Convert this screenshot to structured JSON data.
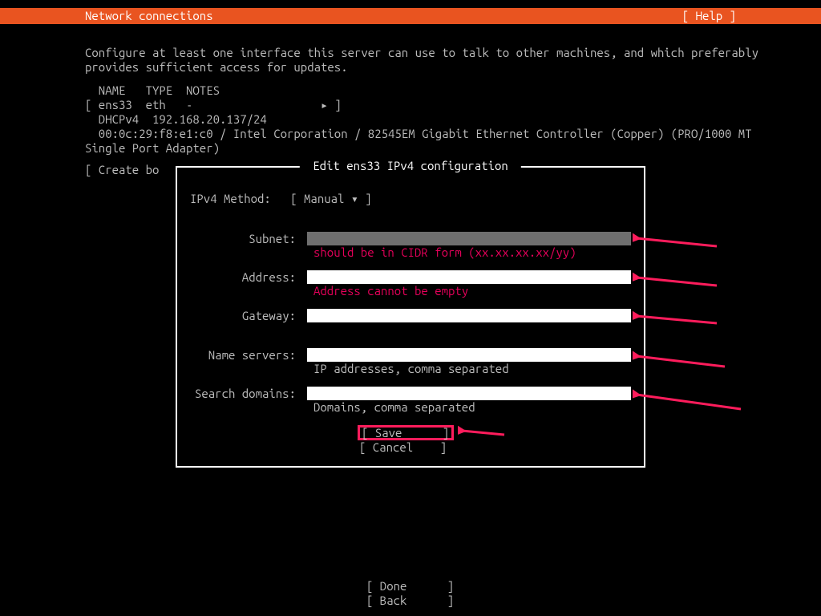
{
  "header": {
    "title": "Network connections",
    "help": "[ Help ]"
  },
  "instructions_line1": "Configure at least one interface this server can use to talk to other machines, and which preferably",
  "instructions_line2": "provides sufficient access for updates.",
  "iface": {
    "hdr": "  NAME   TYPE  NOTES",
    "row": "[ ens33  eth   -                   ▸ ]",
    "dhcp": "  DHCPv4  192.168.20.137/24",
    "mac1": "  00:0c:29:f8:e1:c0 / Intel Corporation / 82545EM Gigabit Ethernet Controller (Copper) (PRO/1000 MT",
    "mac2": "Single Port Adapter)"
  },
  "create_bo": "[ Create bo",
  "dialog": {
    "title": " Edit ens33 IPv4 configuration ",
    "method_label": "IPv4 Method:",
    "method_value": "[ Manual           ▾ ]",
    "subnet_label": "Subnet:",
    "subnet_error": "should be in CIDR form (xx.xx.xx.xx/yy)",
    "address_label": "Address:",
    "address_error": "Address cannot be empty",
    "gateway_label": "Gateway:",
    "ns_label": "Name servers:",
    "ns_hint": "IP addresses, comma separated",
    "sd_label": "Search domains:",
    "sd_hint": "Domains, comma separated",
    "save": "[ Save      ]",
    "cancel": "[ Cancel    ]"
  },
  "footer": {
    "done": "[ Done      ]",
    "back": "[ Back      ]"
  }
}
